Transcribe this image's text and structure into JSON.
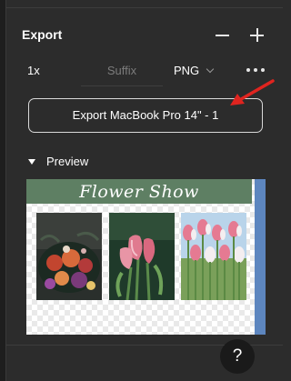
{
  "export": {
    "title": "Export",
    "scale": "1x",
    "suffix_placeholder": "Suffix",
    "format": "PNG",
    "export_button_label": "Export MacBook Pro 14\" - 1"
  },
  "preview": {
    "label": "Preview",
    "banner_text": "Flower Show",
    "images": [
      "dark-floral-bouquet",
      "pink-calla-lilies",
      "pink-white-tulips"
    ]
  },
  "help": {
    "label": "?"
  },
  "icons": [
    "minus-icon",
    "plus-icon",
    "chevron-down-icon",
    "more-icon",
    "collapse-caret-icon",
    "red-arrow-annotation"
  ],
  "colors": {
    "panel_bg": "#2c2c2c",
    "banner_green": "#5e7f63",
    "preview_side_blue": "#5d86bf",
    "annotation_red": "#e0241f"
  }
}
